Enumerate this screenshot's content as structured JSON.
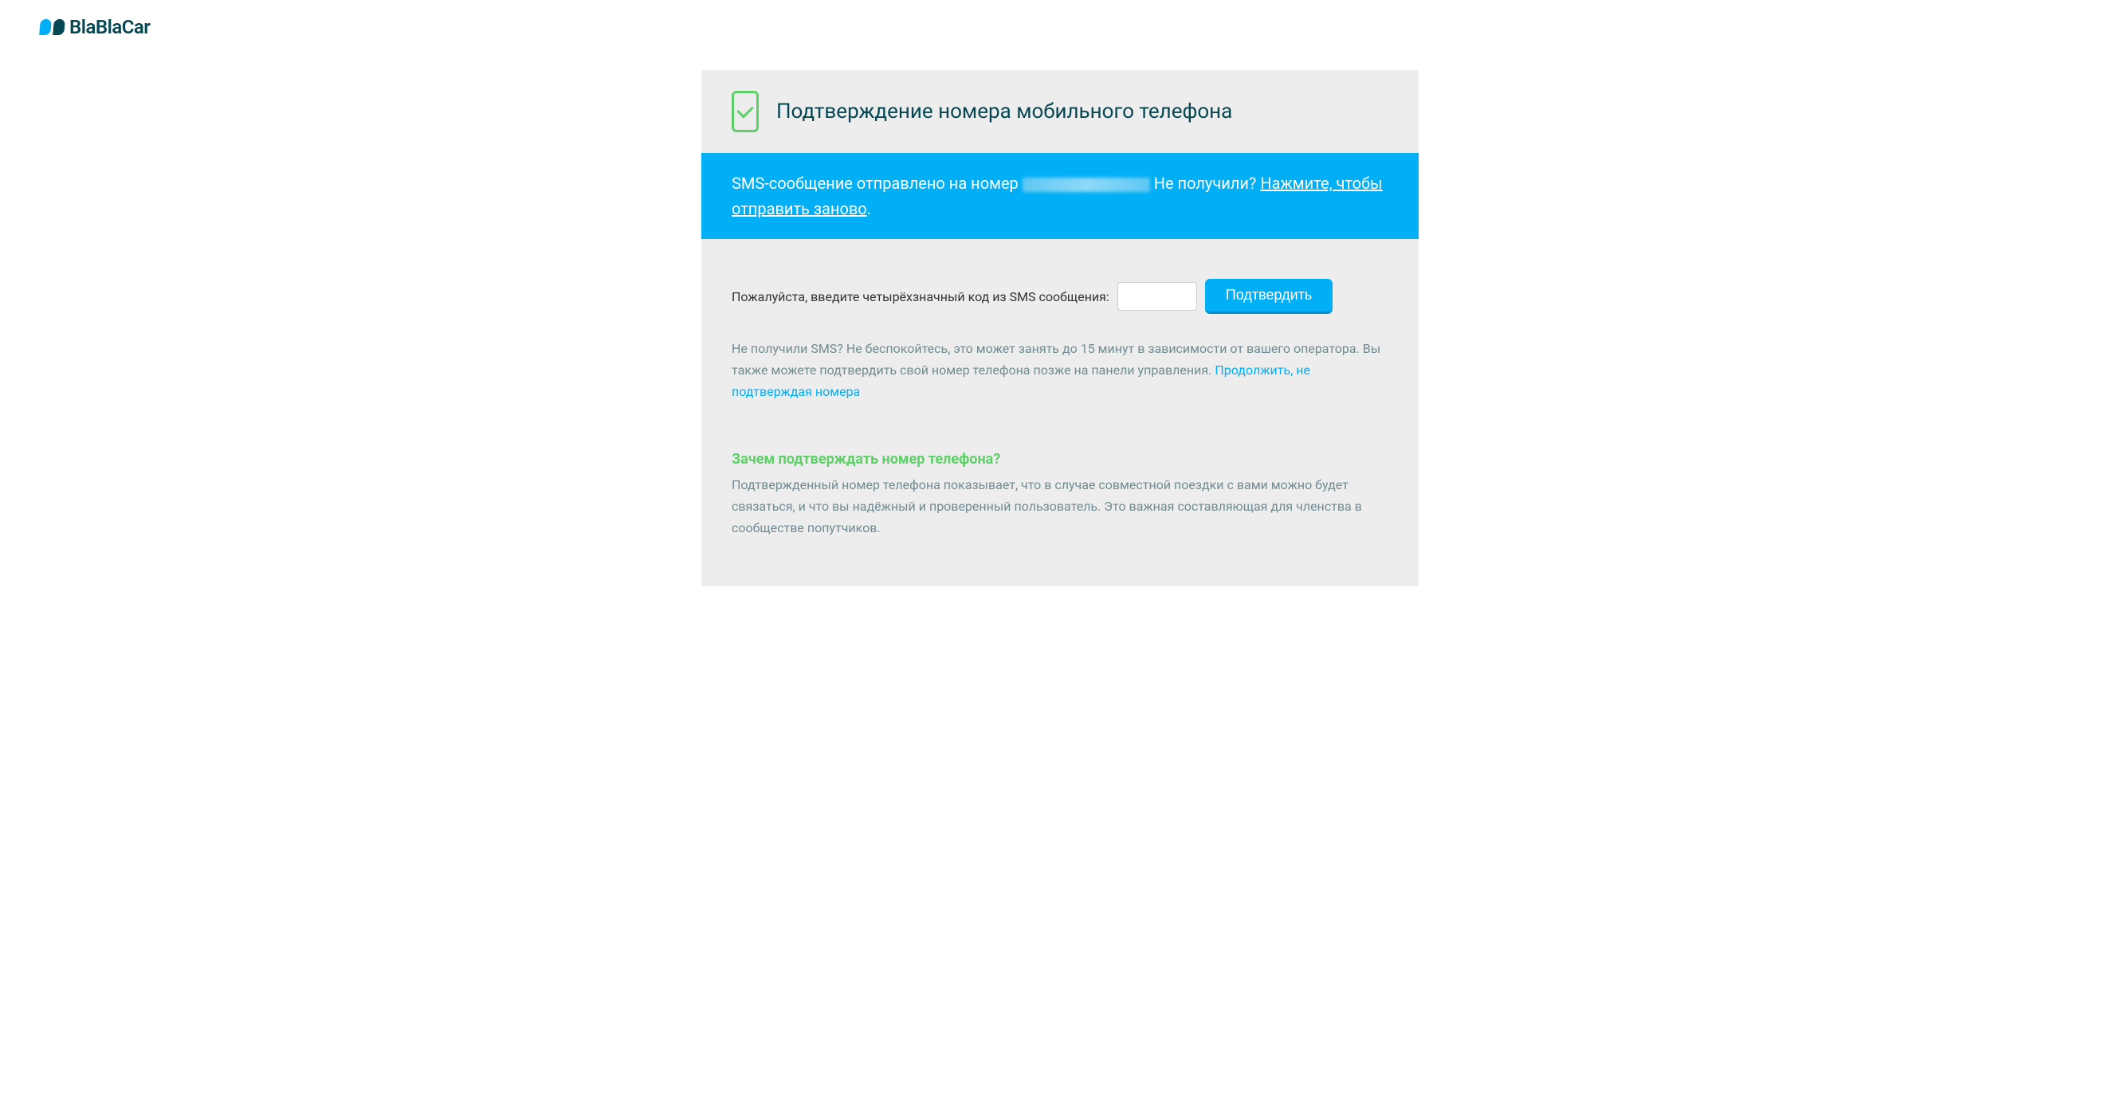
{
  "logo": {
    "text": "BlaBlaCar"
  },
  "header": {
    "title": "Подтверждение номера мобильного телефона"
  },
  "alert": {
    "prefix": "SMS-сообщение отправлено на номер ",
    "not_received": " Не получили? ",
    "resend_link": "Нажмите, чтобы отправить заново",
    "suffix": "."
  },
  "form": {
    "label": "Пожалуйста, введите четырёхзначный код из SMS сообщения:",
    "button": "Подтвердить"
  },
  "help": {
    "text": "Не получили SMS? Не беспокойтесь, это может занять до 15 минут в зависимости от вашего оператора. Вы также можете подтвердить свой номер телефона позже на панели управления. ",
    "continue_link": "Продолжить, не подтверждая номера"
  },
  "why": {
    "title": "Зачем подтверждать номер телефона?",
    "text": "Подтвержденный номер телефона показывает, что в случае совместной поездки с вами можно будет связаться, и что вы надёжный и проверенный пользователь. Это важная составляющая для членства в сообществе попутчиков."
  }
}
